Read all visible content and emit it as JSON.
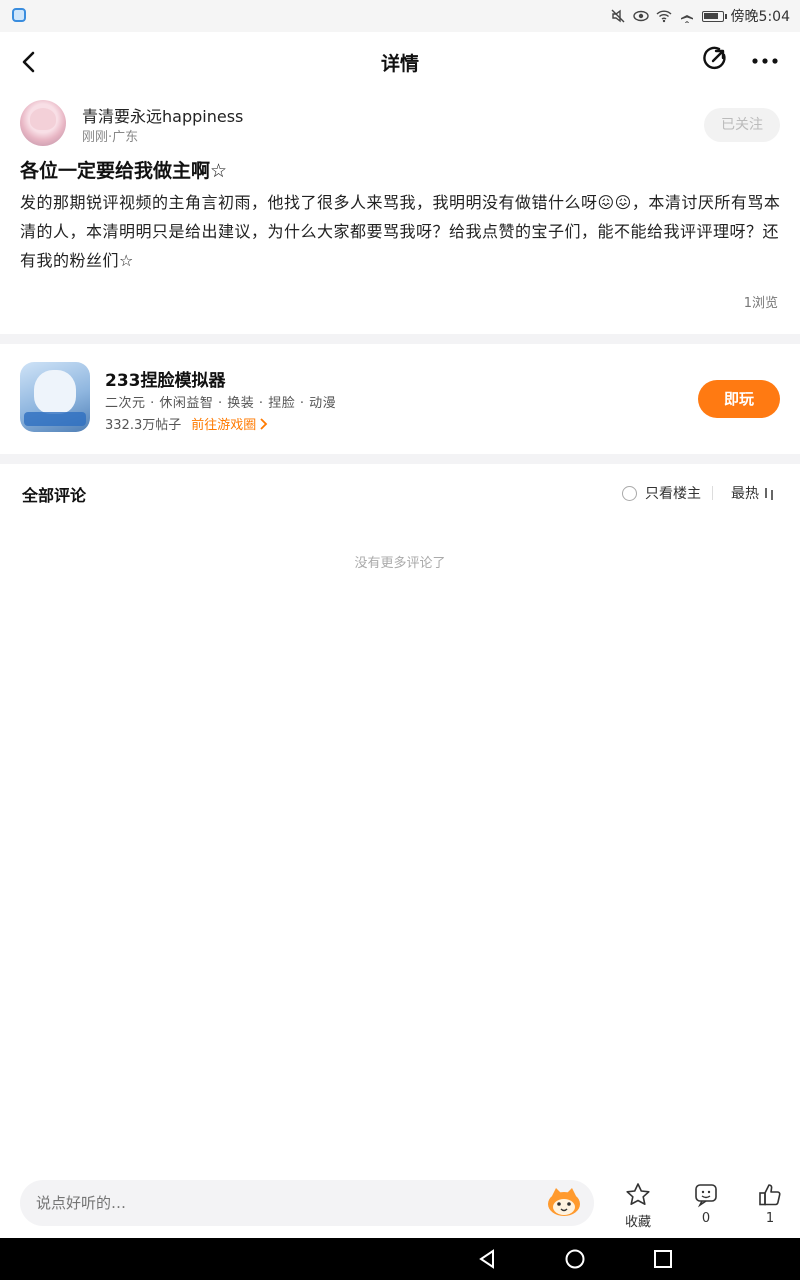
{
  "status_bar": {
    "time": "傍晚5:04",
    "battery_level": 0.8
  },
  "nav": {
    "title": "详情"
  },
  "author": {
    "name": "青清要永远happiness",
    "meta": "刚刚·广东",
    "follow_label": "已关注"
  },
  "post": {
    "title": "各位一定要给我做主啊☆",
    "body": "发的那期锐评视频的主角言初雨，他找了很多人来骂我，我明明没有做错什么呀😖😖，本清讨厌所有骂本清的人，本清明明只是给出建议，为什么大家都要骂我呀？给我点赞的宝子们，能不能给我评评理呀？还有我的粉丝们☆",
    "views": "1浏览"
  },
  "game": {
    "name": "233捏脸模拟器",
    "tags": "二次元 · 休闲益智 · 换装 · 捏脸 · 动漫",
    "posts": "332.3万帖子",
    "link_label": "前往游戏圈",
    "play_label": "即玩"
  },
  "comments": {
    "header": "全部评论",
    "only_owner_label": "只看楼主",
    "sort_label": "最热",
    "empty_text": "没有更多评论了"
  },
  "bottom": {
    "input_placeholder": "说点好听的…",
    "favorite_label": "收藏",
    "comment_count": "0",
    "like_count": "1"
  },
  "colors": {
    "accent": "#ff7a12",
    "link": "#ff7a00",
    "divider": "#f3f3f5"
  }
}
